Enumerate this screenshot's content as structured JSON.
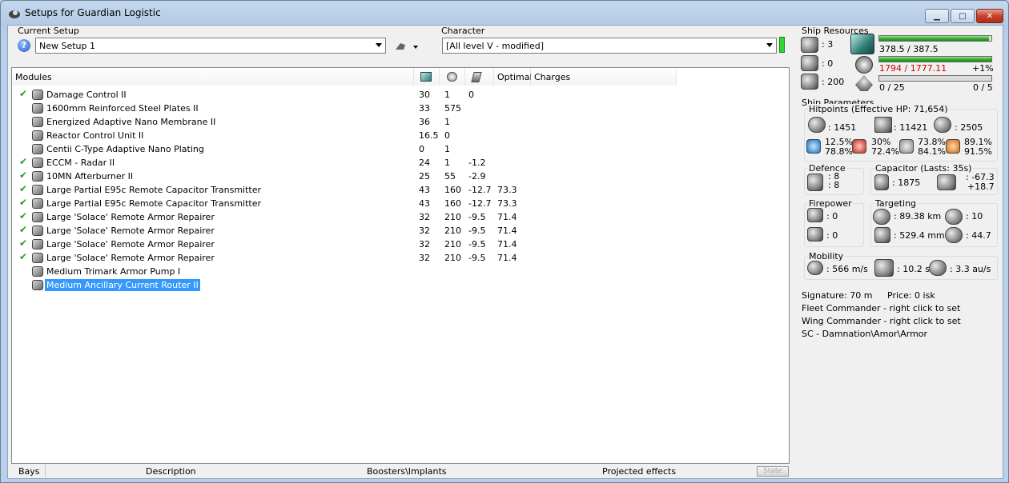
{
  "window": {
    "title": "Setups for Guardian Logistic",
    "controls": {
      "minimize": "▁",
      "maximize": "□",
      "close": "✕"
    }
  },
  "setup": {
    "label": "Current Setup",
    "value": "New Setup 1"
  },
  "character": {
    "label": "Character",
    "value": "[All level V - modified]",
    "status_color": "#2ed82e"
  },
  "modules": {
    "headers": {
      "name": "Modules",
      "optimal": "Optimal",
      "charges": "Charges"
    },
    "rows": [
      {
        "name": "Damage Control II",
        "active": true,
        "cpu": "30",
        "pg": "1",
        "cap": "0",
        "optimal": ""
      },
      {
        "name": "1600mm Reinforced Steel Plates II",
        "active": false,
        "cpu": "33",
        "pg": "575",
        "cap": "",
        "optimal": ""
      },
      {
        "name": "Energized Adaptive Nano Membrane II",
        "active": false,
        "cpu": "36",
        "pg": "1",
        "cap": "",
        "optimal": ""
      },
      {
        "name": "Reactor Control Unit II",
        "active": false,
        "cpu": "16.5",
        "pg": "0",
        "cap": "",
        "optimal": ""
      },
      {
        "name": "Centii C-Type Adaptive Nano Plating",
        "active": false,
        "cpu": "0",
        "pg": "1",
        "cap": "",
        "optimal": ""
      },
      {
        "name": "ECCM - Radar II",
        "active": true,
        "cpu": "24",
        "pg": "1",
        "cap": "-1.2",
        "optimal": ""
      },
      {
        "name": "10MN Afterburner II",
        "active": true,
        "cpu": "25",
        "pg": "55",
        "cap": "-2.9",
        "optimal": ""
      },
      {
        "name": "Large Partial E95c Remote Capacitor Transmitter",
        "active": true,
        "cpu": "43",
        "pg": "160",
        "cap": "-12.7",
        "optimal": "73.3"
      },
      {
        "name": "Large Partial E95c Remote Capacitor Transmitter",
        "active": true,
        "cpu": "43",
        "pg": "160",
        "cap": "-12.7",
        "optimal": "73.3"
      },
      {
        "name": "Large 'Solace' Remote Armor Repairer",
        "active": true,
        "cpu": "32",
        "pg": "210",
        "cap": "-9.5",
        "optimal": "71.4"
      },
      {
        "name": "Large 'Solace' Remote Armor Repairer",
        "active": true,
        "cpu": "32",
        "pg": "210",
        "cap": "-9.5",
        "optimal": "71.4"
      },
      {
        "name": "Large 'Solace' Remote Armor Repairer",
        "active": true,
        "cpu": "32",
        "pg": "210",
        "cap": "-9.5",
        "optimal": "71.4"
      },
      {
        "name": "Large 'Solace' Remote Armor Repairer",
        "active": true,
        "cpu": "32",
        "pg": "210",
        "cap": "-9.5",
        "optimal": "71.4"
      },
      {
        "name": "Medium Trimark Armor Pump I",
        "active": false,
        "cpu": "",
        "pg": "",
        "cap": "",
        "optimal": ""
      },
      {
        "name": "Medium Ancillary Current Router II",
        "active": false,
        "cpu": "",
        "pg": "",
        "cap": "",
        "optimal": "",
        "selected": true
      }
    ]
  },
  "bottom_tabs": {
    "bays": "Bays",
    "description": "Description",
    "boosters": "Boosters\\Implants",
    "projected": "Projected effects",
    "state": "State"
  },
  "resources": {
    "title": "Ship Resources",
    "turrets": ": 3",
    "launchers": ": 0",
    "calibration": ": 200",
    "cpu": {
      "text": "378.5 / 387.5",
      "fraction": 0.977
    },
    "pg": {
      "text": "1794 / 1777.11",
      "extra": "+1%",
      "fraction": 1.0,
      "over_color": "#cc0000"
    },
    "drones": {
      "bandwidth": "0 / 25",
      "count": "0 / 5"
    }
  },
  "params": {
    "title": "Ship Parameters",
    "hp": {
      "title": "Hitpoints (Effective HP: 71,654)",
      "shield": ": 1451",
      "armor": ": 11421",
      "hull": ": 2505",
      "r1a": "12.5%",
      "r1b": "78.8%",
      "r2a": "30%",
      "r2b": "72.4%",
      "r3a": "73.8%",
      "r3b": "84.1%",
      "r4a": "89.1%",
      "r4b": "91.5%"
    },
    "defence": {
      "title": "Defence",
      "a": ": 8",
      "b": ": 8"
    },
    "capacitor": {
      "title": "Capacitor (Lasts: 35s)",
      "amount": ": 1875",
      "a": ": -67.3",
      "b": "+18.7"
    },
    "firepower": {
      "title": "Firepower",
      "a": ": 0",
      "b": ": 0"
    },
    "targeting": {
      "title": "Targeting",
      "range": ": 89.38 km",
      "targets": ": 10",
      "scan": ": 529.4 mm",
      "sensor": ": 44.7"
    },
    "mobility": {
      "title": "Mobility",
      "speed": ": 566 m/s",
      "align": ": 10.2 s",
      "warp": ": 3.3 au/s"
    }
  },
  "info": {
    "signature": "Signature: 70 m",
    "price": "Price: 0 isk",
    "fleet": "Fleet Commander - right click to set",
    "wing": "Wing Commander - right click to set",
    "sc": "SC - Damnation\\Amor\\Armor"
  }
}
